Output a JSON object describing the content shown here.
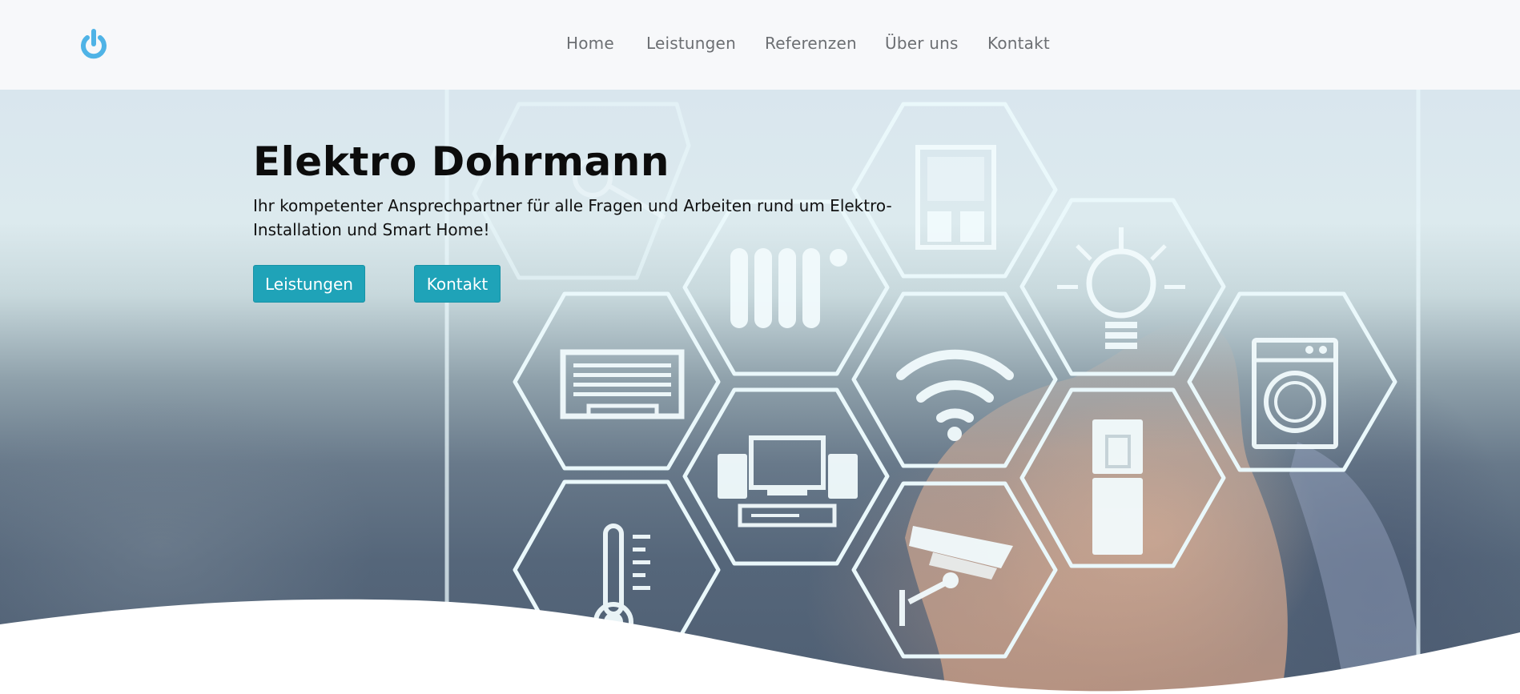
{
  "brand": {
    "logo_icon": "power-icon",
    "logo_color": "#4fb3e6"
  },
  "nav": {
    "items": [
      {
        "label": "Home"
      },
      {
        "label": "Leistungen"
      },
      {
        "label": "Referenzen"
      },
      {
        "label": "Über uns"
      },
      {
        "label": "Kontakt"
      }
    ]
  },
  "hero": {
    "title": "Elektro Dohrmann",
    "subtitle": "Ihr kompetenter Ansprechpartner für alle Fragen und Arbeiten rund um Elektro-Installation und Smart Home!",
    "buttons": [
      {
        "label": "Leistungen"
      },
      {
        "label": "Kontakt"
      }
    ],
    "accent_color": "#1fa3b8",
    "icons": [
      "key-icon",
      "radiator-icon",
      "window-icon",
      "lightbulb-icon",
      "garage-door-icon",
      "wifi-icon",
      "washing-machine-icon",
      "stereo-tv-icon",
      "fridge-icon",
      "thermometer-icon",
      "security-camera-icon"
    ]
  }
}
